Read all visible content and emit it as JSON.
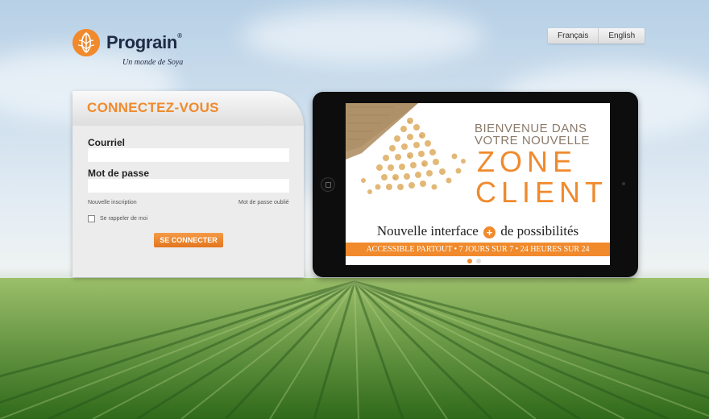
{
  "brand": {
    "name": "Prograin",
    "registered": "®",
    "tagline": "Un monde de Soya"
  },
  "language": {
    "options": [
      "Français",
      "English"
    ]
  },
  "login": {
    "title": "CONNECTEZ-VOUS",
    "email_label": "Courriel",
    "email_value": "",
    "password_label": "Mot de passe",
    "password_value": "",
    "new_account_link": "Nouvelle inscription",
    "forgot_password_link": "Mot de passe oublié",
    "remember_label": "Se rappeler de moi",
    "submit_label": "SE CONNECTER"
  },
  "banner": {
    "line1": "BIENVENUE DANS",
    "line2": "VOTRE NOUVELLE",
    "zone": "ZONE",
    "client": "CLIENT",
    "tagline_before": "Nouvelle interface",
    "tagline_plus": "+",
    "tagline_after": "de possibilités",
    "band": "ACCESSIBLE PARTOUT • 7 JOURS SUR 7 • 24 HEURES SUR 24"
  },
  "colors": {
    "accent": "#f08a2c",
    "brand_dark": "#1f2a44"
  },
  "icons": {
    "logo": "soy-leaf-logo",
    "tablet_home": "home-button-icon"
  }
}
